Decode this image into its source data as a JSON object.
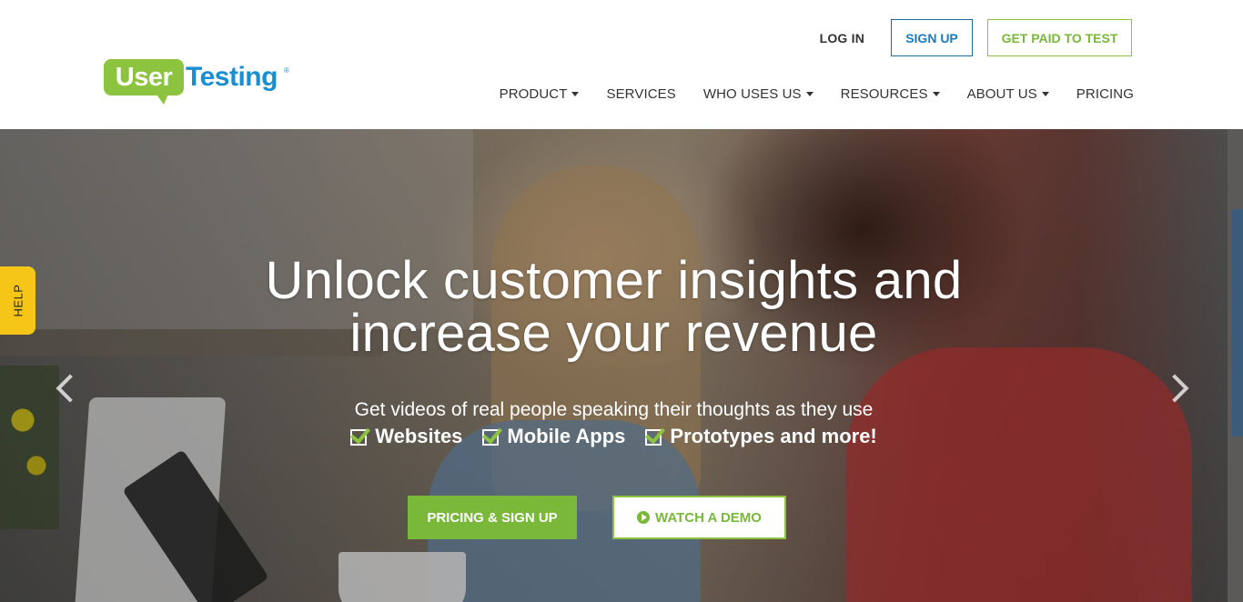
{
  "brand": {
    "logo_left": "User",
    "logo_right": "Testing",
    "logo_mark": "®",
    "green": "#8cc43f",
    "blue": "#1a8ecf"
  },
  "top_links": {
    "login": "LOG IN",
    "signup": "SIGN UP",
    "get_paid": "GET PAID TO TEST"
  },
  "nav": {
    "items": [
      {
        "label": "PRODUCT",
        "dropdown": true
      },
      {
        "label": "SERVICES",
        "dropdown": false
      },
      {
        "label": "WHO USES US",
        "dropdown": true
      },
      {
        "label": "RESOURCES",
        "dropdown": true
      },
      {
        "label": "ABOUT US",
        "dropdown": true
      },
      {
        "label": "PRICING",
        "dropdown": false
      }
    ]
  },
  "hero": {
    "headline_line1": "Unlock customer insights and",
    "headline_line2": "increase your revenue",
    "subline": "Get videos of real people speaking their thoughts as they use",
    "features": [
      "Websites",
      "Mobile Apps",
      "Prototypes and more!"
    ],
    "cta_primary": "PRICING & SIGN UP",
    "cta_secondary": "WATCH A DEMO",
    "prev_icon": "chevron-left-icon",
    "next_icon": "chevron-right-icon"
  },
  "help": {
    "label": "HELP",
    "color": "#f5c518"
  }
}
